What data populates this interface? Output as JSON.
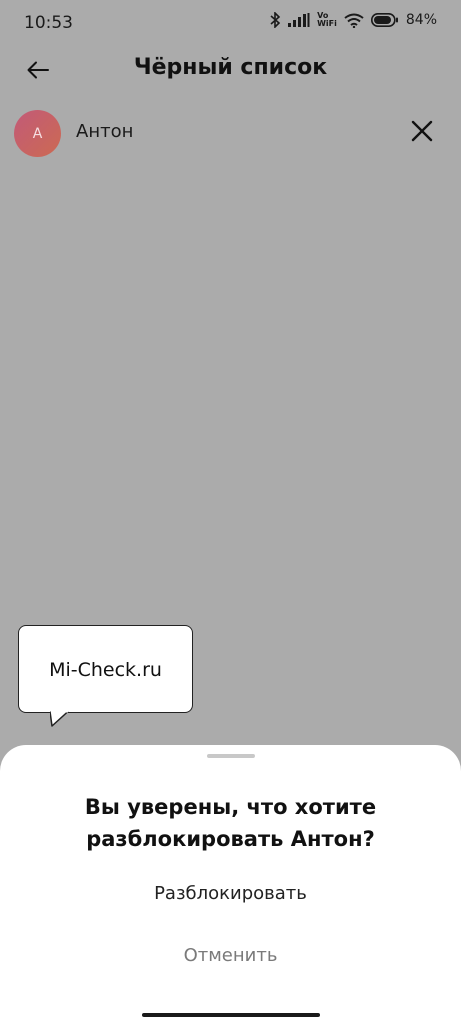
{
  "status_bar": {
    "time": "10:53",
    "network_label_top": "Vo",
    "network_label_bottom": "WiFi",
    "battery": "84%",
    "icons": [
      "bluetooth-icon",
      "signal-icon",
      "vowifi-icon",
      "wifi-icon",
      "battery-icon"
    ]
  },
  "header": {
    "title": "Чёрный список",
    "back_icon": "arrow-left-icon"
  },
  "contact": {
    "initial": "А",
    "name": "Антон",
    "remove_icon": "close-icon"
  },
  "watermark": {
    "text": "Mi-Check.ru"
  },
  "sheet": {
    "title_line1": "Вы уверены, что хотите",
    "title_line2": "разблокировать Антон?",
    "confirm_label": "Разблокировать",
    "cancel_label": "Отменить"
  },
  "colors": {
    "overlay": "#ababab",
    "sheet": "#ffffff",
    "avatar_gradient_start": "#c25a78",
    "avatar_gradient_end": "#cc6a52",
    "cancel_text": "#7a7a7a"
  }
}
